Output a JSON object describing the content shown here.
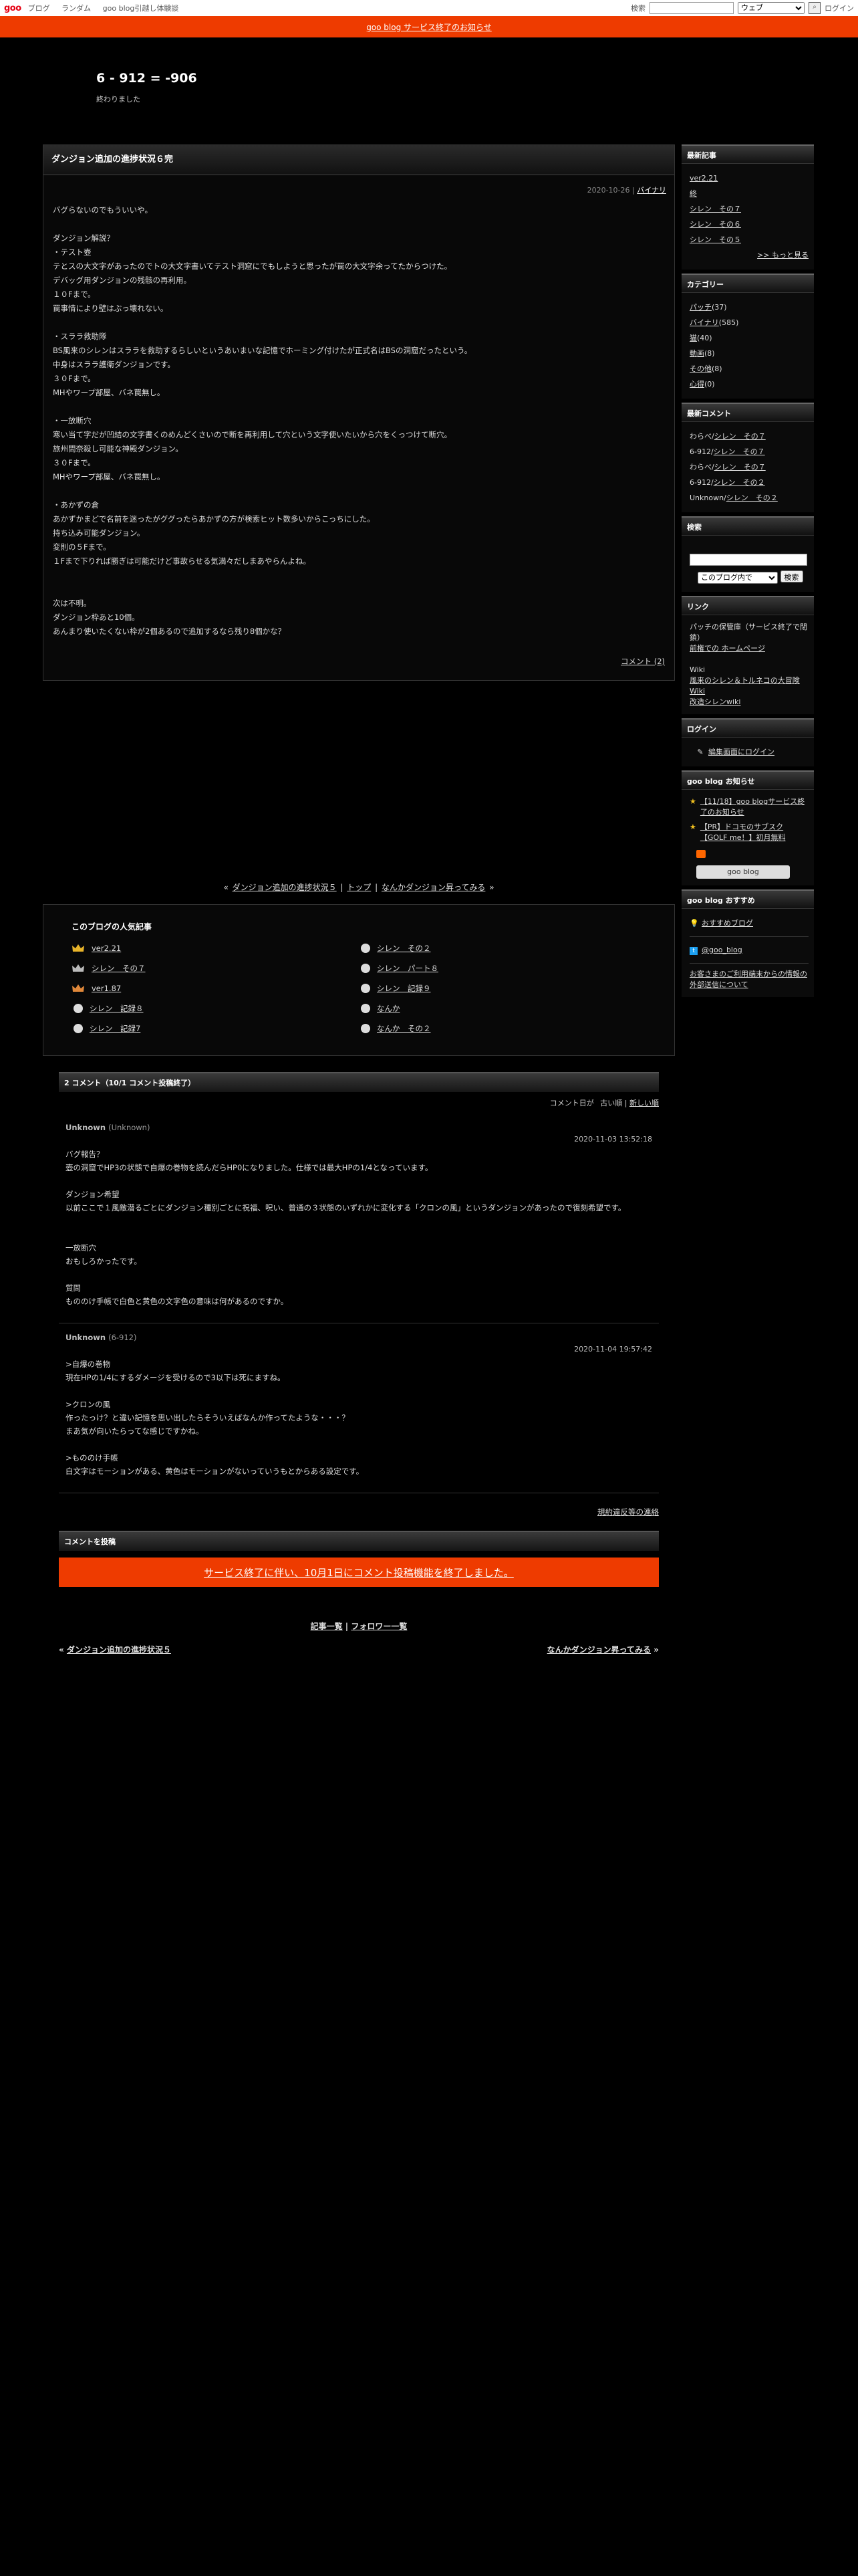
{
  "topbar": {
    "logo": "goo",
    "nav": [
      "ブログ",
      "ランダム",
      "goo blog引越し体験談"
    ],
    "search_label": "検索",
    "search_scope": "ウェブ",
    "login": "ログイン"
  },
  "notice": "goo blog サービス終了のお知らせ",
  "header": {
    "title": "6 - 912 = -906",
    "description": "終わりました"
  },
  "entry": {
    "title": "ダンジョン追加の進捗状況６完",
    "date": "2020-10-26",
    "category": "バイナリ",
    "body": "バグらないのでもういいや。\n\nダンジョン解説？\n・テスト壺\nテとスの大文字があったのでトの大文字書いてテスト洞窟にでもしようと思ったが罠の大文字余ってたからつけた。\nデバッグ用ダンジョンの残骸の再利用。\n１０Fまで。\n罠事情により壁はぶっ壊れない。\n\n・スララ救助隊\nBS風来のシレンはスララを救助するらしいというあいまいな記憶でホーミング付けたが正式名はBSの洞窟だったという。\n中身はスララ護衛ダンジョンです。\n３０Fまで。\nMHやワープ部屋、バネ罠無し。\n\n・一放断穴\n寒い当て字だが凹結の文字書くのめんどくさいので断を再利用して穴という文字使いたいから穴をくっつけて断穴。\n旅州間奈殺し可能な神殿ダンジョン。\n３０Fまで。\nMHやワープ部屋、バネ罠無し。\n\n・あかずの倉\nあかずかまどで名前を迷ったがググったらあかずの方が検索ヒット数多いからこっちにした。\n持ち込み可能ダンジョン。\n変則の５Fまで。\n１Fまで下りれば勝ぎは可能だけど事故らせる気満々だしまあやらんよね。\n\n\n次は不明。\nダンジョン枠あと10個。\nあんまり使いたくない枠が2個あるので追加するなら残り8個かな？",
    "comments_link": "コメント (2)"
  },
  "pager": {
    "prev": "ダンジョン追加の進捗状況５",
    "top": "トップ",
    "next": "なんかダンジョン昇ってみる"
  },
  "popular": {
    "heading": "このブログの人気記事",
    "items": [
      "ver2.21",
      "シレン　その２",
      "シレン　その７",
      "シレン　パート８",
      "ver1.87",
      "シレン　記録９",
      "シレン　記録８",
      "なんか",
      "シレン　記録7",
      "なんか　その２"
    ]
  },
  "comments": {
    "heading": "2 コメント（10/1 コメント投稿終了）",
    "sort_label": "コメント日が",
    "sort_old": "古い順",
    "sort_new": "新しい順",
    "items": [
      {
        "author": "Unknown",
        "id": "(Unknown)",
        "date": "2020-11-03 13:52:18",
        "body": "バグ報告？\n壺の洞窟でHP3の状態で自爆の巻物を読んだらHP0になりました。仕様では最大HPの1/4となっています。\n\nダンジョン希望\n以前ここで１風敵潜るごとにダンジョン種別ごとに祝福、呪い、普通の３状態のいずれかに変化する「クロンの風」というダンジョンがあったので復刻希望です。\n\n\n一放断穴\nおもしろかったです。\n\n質問\nもののけ手帳で白色と黄色の文字色の意味は何があるのですか。"
      },
      {
        "author": "Unknown",
        "id": "(6-912)",
        "date": "2020-11-04 19:57:42",
        "body": ">自爆の巻物\n現在HPの1/4にするダメージを受けるので3以下は死にますね。\n\n>クロンの風\n作ったっけ？と違い記憶を思い出したらそういえばなんか作ってたような・・・？\nまあ気が向いたらってな感じですかね。\n\n>もののけ手帳\n白文字はモーションがある、黄色はモーションがないっていうもとからある設定です。"
      }
    ],
    "terms_link": "規約違反等の連絡",
    "post_heading": "コメントを投稿",
    "post_closed": "サービス終了に伴い、10月1日にコメント投稿機能を終了しました。",
    "list_link": "記事一覧",
    "follow_link": "フォロワー一覧",
    "prev_entry": "ダンジョン追加の進捗状況５",
    "next_entry": "なんかダンジョン昇ってみる"
  },
  "sidebar": {
    "recent_heading": "最新記事",
    "recent": [
      "ver2.21",
      "終",
      "シレン　その７",
      "シレン　その６",
      "シレン　その５"
    ],
    "more": ">> もっと見る",
    "cat_heading": "カテゴリー",
    "categories": [
      {
        "name": "パッチ",
        "count": "(37)"
      },
      {
        "name": "バイナリ",
        "count": "(585)"
      },
      {
        "name": "猫",
        "count": "(40)"
      },
      {
        "name": "動画",
        "count": "(8)"
      },
      {
        "name": "その他",
        "count": "(8)"
      },
      {
        "name": "心得",
        "count": "(0)"
      }
    ],
    "rc_heading": "最新コメント",
    "recent_comments": [
      {
        "who": "わらべ/",
        "post": "シレン　その７"
      },
      {
        "who": "6-912/",
        "post": "シレン　その７"
      },
      {
        "who": "わらべ/",
        "post": "シレン　その７"
      },
      {
        "who": "6-912/",
        "post": "シレン　その２"
      },
      {
        "who": "Unknown/",
        "post": "シレン　その２"
      }
    ],
    "search_heading": "検索",
    "search_scope": "このブログ内で",
    "search_btn": "検索",
    "link_heading": "リンク",
    "link_desc": "パッチの保管庫（サービス終了で閉鎖）",
    "link1": "前権での ホームページ",
    "wiki_label": "Wiki",
    "wiki1": "風来のシレン＆トルネコの大冒険 Wiki",
    "wiki2": "改造シレンwiki",
    "login_heading": "ログイン",
    "login_link": "編集画面にログイン",
    "news_heading": "goo blog お知らせ",
    "news": [
      "【11/18】goo blogサービス終了のお知らせ",
      "【PR】ドコモのサブスク【GOLF me！】初月無料"
    ],
    "goo_button": "goo blog",
    "rec_heading": "goo blog おすすめ",
    "rec_link": "おすすめブログ",
    "twitter": "@goo_blog",
    "footer_link": "お客さまのご利用端末からの情報の外部送信について"
  }
}
